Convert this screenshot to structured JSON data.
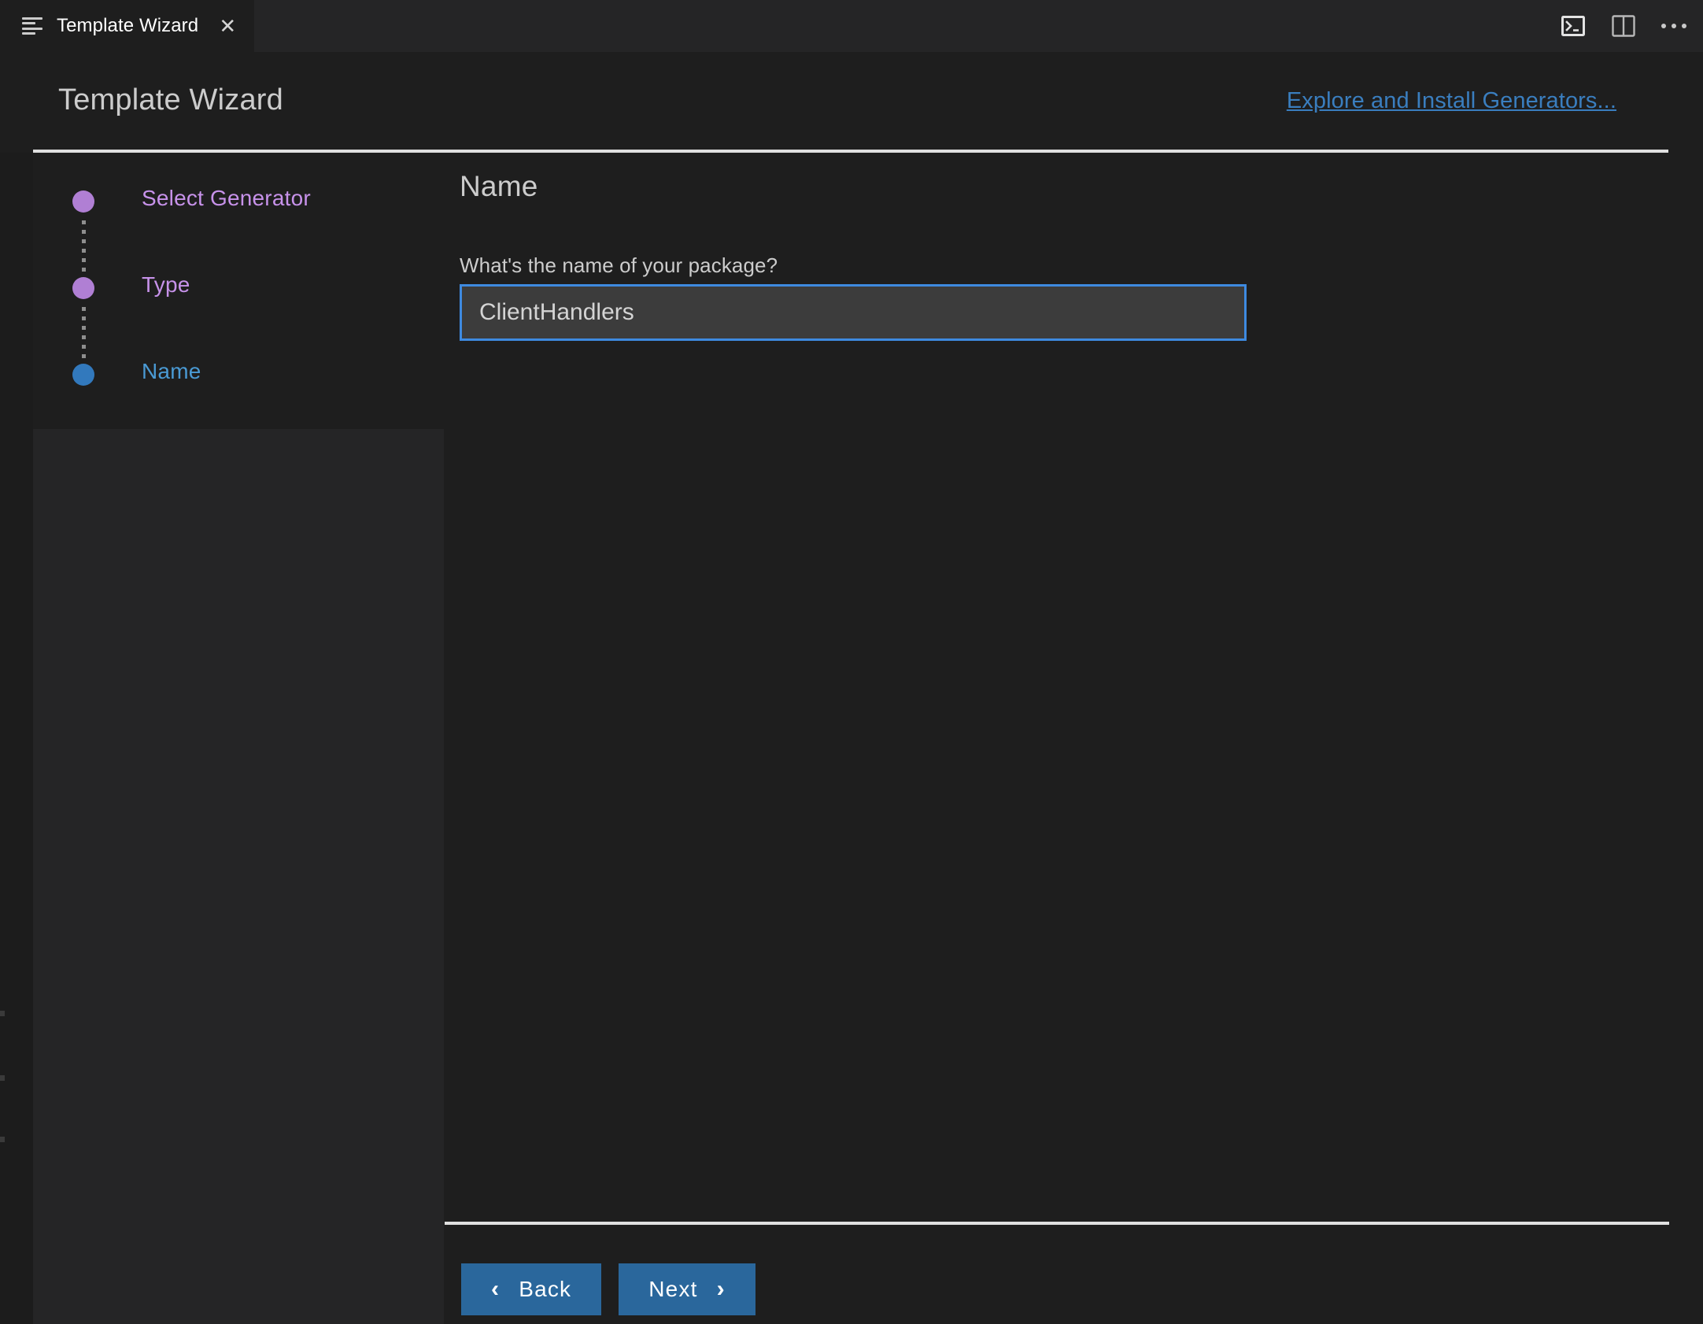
{
  "tab": {
    "title": "Template Wizard",
    "menu_icon": "hamburger-menu-icon",
    "close_icon": "close-icon",
    "actions": [
      {
        "name": "terminal-icon",
        "label": ">_"
      },
      {
        "name": "split-editor-icon",
        "label": ""
      },
      {
        "name": "more-actions-icon",
        "label": ""
      }
    ]
  },
  "header": {
    "title": "Template Wizard",
    "link": "Explore and Install Generators..."
  },
  "steps": [
    {
      "label": "Select Generator",
      "state": "done",
      "color": "#b07fd4"
    },
    {
      "label": "Type",
      "state": "done",
      "color": "#b07fd4"
    },
    {
      "label": "Name",
      "state": "active",
      "color": "#3279bd"
    }
  ],
  "main": {
    "section_title": "Name",
    "question": "What's the name of your package?",
    "input_value": "ClientHandlers",
    "input_placeholder": ""
  },
  "footer": {
    "back_label": "Back",
    "next_label": "Next",
    "back_chevron": "‹",
    "next_chevron": "›"
  },
  "colors": {
    "accent_blue": "#3a7ebf",
    "button_blue": "#2a679c",
    "step_done": "#b07fd4",
    "step_active": "#3279bd",
    "input_border": "#3e8ae0",
    "input_bg": "#3c3c3c",
    "background": "#1e1e1e",
    "panel": "#252526"
  }
}
